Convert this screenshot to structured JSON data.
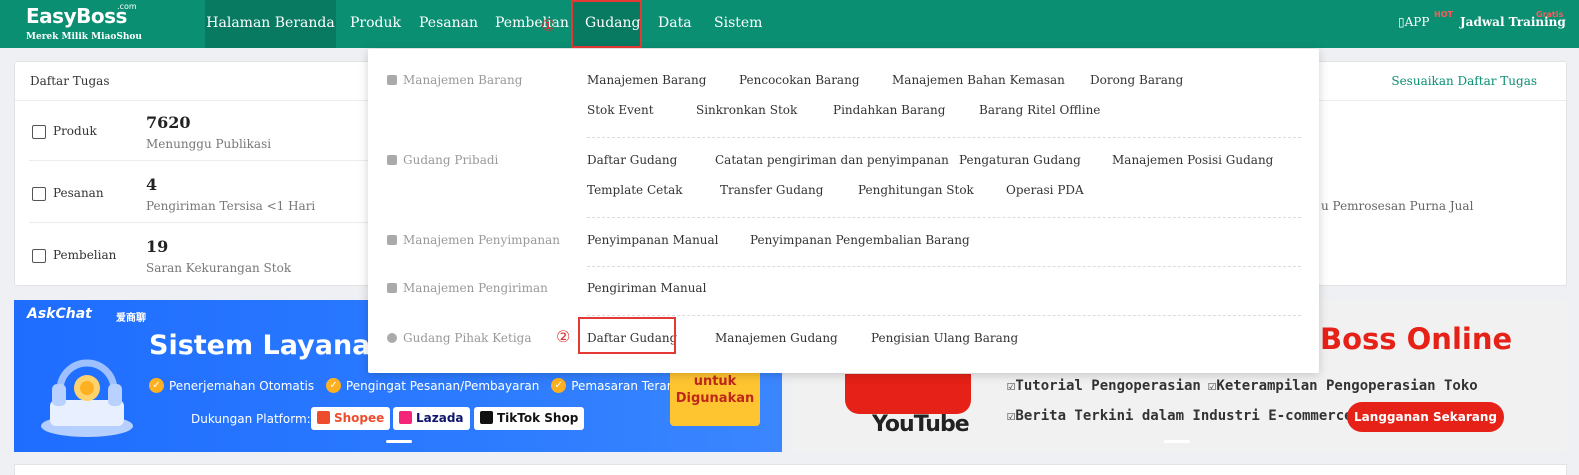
{
  "brand": {
    "name": "EasyBoss",
    "tld": ".com",
    "tagline": "Merek Milik MiaoShou"
  },
  "nav": {
    "items": [
      "Halaman Beranda",
      "Produk",
      "Pesanan",
      "Pembelian",
      "Gudang",
      "Data",
      "Sistem"
    ],
    "step1_marker": "①",
    "app": "APP",
    "app_badge": "HOT",
    "training": "Jadwal Training",
    "training_badge": "Gratis"
  },
  "tasks": {
    "title": "Daftar Tugas",
    "customize": "Sesuaikan Daftar Tugas",
    "rows": [
      {
        "label": "Produk",
        "count": "7620",
        "desc": "Menunggu Publikasi"
      },
      {
        "label": "Pesanan",
        "count": "4",
        "desc": "Pengiriman Tersisa <1 Hari"
      },
      {
        "label": "Pembelian",
        "count": "19",
        "desc": "Saran Kekurangan Stok"
      }
    ],
    "partial_text": "u Pemrosesan Purna Jual"
  },
  "dropdown": {
    "step2_marker": "②",
    "sections": [
      {
        "category": "Manajemen Barang",
        "items": [
          "Manajemen Barang",
          "Pencocokan Barang",
          "Manajemen Bahan Kemasan",
          "Dorong Barang",
          "Stok Event",
          "Sinkronkan Stok",
          "Pindahkan Barang",
          "Barang Ritel Offline"
        ]
      },
      {
        "category": "Gudang Pribadi",
        "items": [
          "Daftar Gudang",
          "Catatan pengiriman dan penyimpanan",
          "Pengaturan Gudang",
          "Manajemen Posisi Gudang",
          "Template Cetak",
          "Transfer Gudang",
          "Penghitungan Stok",
          "Operasi PDA"
        ]
      },
      {
        "category": "Manajemen Penyimpanan",
        "items": [
          "Penyimpanan Manual",
          "Penyimpanan Pengembalian Barang"
        ]
      },
      {
        "category": "Manajemen Pengiriman",
        "items": [
          "Pengiriman Manual"
        ]
      },
      {
        "category": "Gudang Pihak Ketiga",
        "items": [
          "Daftar Gudang",
          "Manajemen Gudang",
          "Pengisian Ulang Barang"
        ]
      }
    ]
  },
  "banner_left": {
    "brand": "AskChat",
    "brand_cn": "爱商聊",
    "title": "Sistem Layanan",
    "features": [
      "Penerjemahan Otomatis",
      "Pengingat Pesanan/Pembayaran",
      "Pemasaran Terarah"
    ],
    "platform_label": "Dukungan Platform:",
    "platforms": [
      "Shopee",
      "Lazada",
      "TikTok Shop"
    ],
    "cta": "untuk Digunakan"
  },
  "banner_right": {
    "title": "Boss Online",
    "youtube": "YouTube",
    "features": [
      "☑Tutorial Pengoperasian",
      "☑Keterampilan Pengoperasian Toko",
      "☑Berita Terkini dalam Industri E-commerce"
    ],
    "cta": "Langganan Sekarang"
  },
  "colors": {
    "brand_green": "#0a8f72",
    "highlight_red": "#e53935",
    "banner_blue": "#1f6dff"
  }
}
